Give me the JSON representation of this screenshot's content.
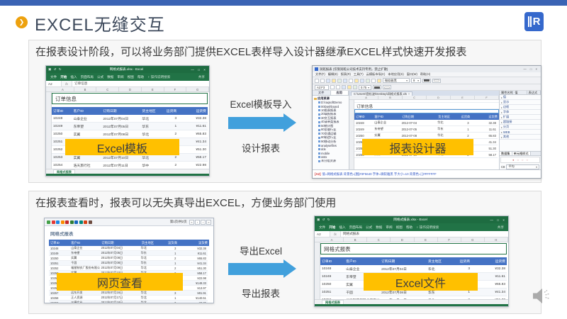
{
  "page": {
    "title": "EXCEL无缝交互",
    "logo_letter": "R",
    "accent_blue": "#3A63B4",
    "bullet_orange": "#EDA10E",
    "label_yellow": "#FFC000",
    "arrow_blue": "#41A0DC"
  },
  "section1": {
    "text": "在报表设计阶段，可以将业务部门提供EXCEL表样导入设计器继承EXCEL样式快速开发报表",
    "arrow_label_top": "Excel模板导入",
    "arrow_label_bottom": "设计报表",
    "overlay_left": "Excel模板",
    "overlay_right": "报表设计器"
  },
  "section2": {
    "text": "在报表查看时，报表可以无失真导出EXCEL，方便业务部门使用",
    "arrow_label_top": "导出Excel",
    "arrow_label_bottom": "导出报表",
    "overlay_left": "网页查看",
    "overlay_right": "Excel文件"
  },
  "excel_template": {
    "window_title": "网格式报表.xlsx - Excel",
    "window_controls": "— □ ×",
    "qat": "▣ ↺ ↻",
    "ribbon_tabs": [
      "文件",
      "开始",
      "插入",
      "页面布局",
      "公式",
      "数据",
      "审阅",
      "视图",
      "帮助"
    ],
    "tell_me": "♀ 操作说明搜索",
    "share": "共享",
    "name_box": "A2",
    "fx": "fx",
    "formula": "订单信息",
    "columns": [
      "A",
      "B",
      "C",
      "D",
      "E",
      "F",
      "G"
    ],
    "title_cell": "订单信息",
    "headers": [
      "订单ID",
      "客户ID",
      "订购日期",
      "货主地区",
      "运货商",
      "运货费"
    ],
    "rows": [
      [
        "10248",
        "山泰企业",
        "2012年07月04日",
        "华北",
        "3",
        "¥32.38"
      ],
      [
        "10249",
        "东帝望",
        "2012年07月05日",
        "华东",
        "1",
        "¥11.61"
      ],
      [
        "10250",
        "实翼",
        "2012年07月08日",
        "华北",
        "2",
        "¥65.83"
      ],
      [
        "10251",
        "千固",
        "2012年07月08日",
        "华东",
        "1",
        "¥41.34"
      ],
      [
        "10252",
        "福星制衣厂股份有限公司",
        "2012年07月09日",
        "华北",
        "2",
        "¥51.30"
      ],
      [
        "10253",
        "实翼",
        "2012年07月10日",
        "华北",
        "2",
        "¥58.17"
      ],
      [
        "10254",
        "浩天旅行社",
        "2012年07月11日",
        "华中",
        "2",
        "¥22.98"
      ]
    ],
    "sheet_tab": "网格式报表"
  },
  "designer": {
    "window_title": "润乾报表 (仅限润乾公司技术支持专用，禁止扩散)",
    "window_controls": "— □ ×",
    "menus": [
      "文件(F)",
      "编辑(E)",
      "报表(R)",
      "工具(T)",
      "云模板市场(C)",
      "本地应用(S)",
      "窗口(W)",
      "帮助(H)"
    ],
    "toolbar1_icons": [
      "new-icon",
      "open-icon",
      "save-icon",
      "save-all-icon",
      "print-icon",
      "bold-icon",
      "italic-icon",
      "underline-icon",
      "align-left-icon",
      "align-center-icon",
      "align-right-icon",
      "merge-cell-icon"
    ],
    "font_name": "微软雅黑",
    "font_size": "9",
    "toolbar2_icons": [
      "paste-icon",
      "format-painter-icon",
      "font-color-icon",
      "fill-color-icon",
      "zoom-icon"
    ],
    "cell_ref": "A2:F3",
    "zoom": "0.75",
    "left_tabs": [
      "文件",
      "应用"
    ],
    "tree_root": "应用资源",
    "tree_items": [
      "D:\\raqsoftDemo",
      "00Dashboard",
      "10图表报表",
      "20填报报表",
      "30交互报表",
      "40清单类报表",
      "50统计图",
      "60金融行业",
      "70交通运输",
      "80制造行业",
      "90移动分析",
      "analysefiles",
      "ddx",
      "mobile",
      "wstx",
      "未分组资源"
    ],
    "doc_tab": "C:\\Users\\登松波\\Desktop\\网格式报表.xls",
    "doc_tab_close": "×",
    "columns": [
      "A",
      "B",
      "C",
      "D",
      "E",
      "F"
    ],
    "title_cell": "订单信息",
    "headers": [
      "订单ID",
      "客户ID",
      "订购日期",
      "货主地区",
      "运货商",
      "运货费"
    ],
    "rows": [
      [
        "10248",
        "山泰企业",
        "2012-07-04",
        "华北",
        "3",
        "32.38"
      ],
      [
        "10249",
        "东帝望",
        "2012-07-05",
        "华东",
        "1",
        "11.61"
      ],
      [
        "10250",
        "实翼",
        "2012-07-08",
        "华北",
        "2",
        "65.83"
      ],
      [
        "10251",
        "千固",
        "2012-07-08",
        "华东",
        "1",
        "41.34"
      ],
      [
        "10252",
        "福星制衣厂股份有限公司",
        "2012-07-09",
        "华北",
        "2",
        "51.30"
      ],
      [
        "10253",
        "实翼",
        "2012-07-10",
        "华北",
        "2",
        "58.17"
      ]
    ],
    "prop_header": [
      "属性名称",
      "值",
      "表达式"
    ],
    "props": [
      "值",
      "显示",
      "边框",
      "字体",
      "扩展",
      "超链接",
      "分页",
      "WEB",
      "其他"
    ],
    "bottom_tabs": [
      "数据集",
      "单元格样式"
    ],
    "radios": [
      "●",
      "○",
      "○",
      "○"
    ],
    "agg_label": "C8",
    "agg_value": "平均",
    "status_ref": "[A2]",
    "status_text": "值=网格式报表 背景色=[图]#3F5640 字体=微软雅黑 字大小=10 背景色=[ ]#FFFFFF"
  },
  "webview": {
    "toolbar_icons": [
      "save-icon",
      "print-icon",
      "export-pdf-icon",
      "export-excel-icon",
      "export-word-icon",
      "export-image-icon",
      "email-icon",
      "print-preview-icon",
      "refresh-icon",
      "setting-icon"
    ],
    "pager_label": "第1页/共2页",
    "nav_buttons": [
      "«",
      "‹",
      "›",
      "»"
    ],
    "report_title": "网格式报表",
    "headers": [
      "订单ID",
      "客户ID",
      "订购日期",
      "货主地区",
      "运货商",
      "运货费"
    ],
    "rows": [
      [
        "10248",
        "山泰企业",
        "2012年07月04日",
        "华北",
        "3",
        "¥32.38"
      ],
      [
        "10249",
        "东帝望",
        "2012年07月05日",
        "华东",
        "1",
        "¥11.61"
      ],
      [
        "10250",
        "实翼",
        "2012年07月08日",
        "华北",
        "2",
        "¥65.83"
      ],
      [
        "10251",
        "千固",
        "2012年07月08日",
        "华东",
        "1",
        "¥41.34"
      ],
      [
        "10252",
        "福星制衣厂股份有限公司",
        "2012年07月09日",
        "华北",
        "2",
        "¥51.30"
      ],
      [
        "10253",
        "实翼",
        "2012年07月10日",
        "华北",
        "2",
        "¥58.17"
      ],
      [
        "10254",
        "浩天旅行社",
        "2012年07月11日",
        "华中",
        "2",
        "¥22.98"
      ],
      [
        "10255",
        "永大企业",
        "2012年07月12日",
        "华北",
        "3",
        "¥148.33"
      ],
      [
        "10256",
        "凯诚国际顾问公司",
        "2012年07月15日",
        "华中",
        "3",
        "¥13.97"
      ],
      [
        "10257",
        "远东开发",
        "2012年07月16日",
        "华北",
        "3",
        "¥81.91"
      ],
      [
        "10258",
        "正人资源",
        "2012年07月17日",
        "华北",
        "1",
        "¥140.51"
      ],
      [
        "10259",
        "三捷实业",
        "2012年07月18日",
        "华北",
        "3",
        "¥3.25"
      ]
    ]
  },
  "excel_export": {
    "window_title": "网格式报表.xlsx - Excel",
    "window_controls": "— □ ×",
    "qat": "▣ ↺ ↻",
    "ribbon_tabs": [
      "文件",
      "开始",
      "插入",
      "页面布局",
      "公式",
      "数据",
      "审阅",
      "视图",
      "帮助"
    ],
    "tell_me": "♀ 操作说明搜索",
    "share": "共享",
    "name_box": "A2",
    "fx": "fx",
    "formula": "网格式报表",
    "columns": [
      "A",
      "B",
      "C",
      "D",
      "E",
      "F",
      "G",
      "H"
    ],
    "title_cell": "网格式报表",
    "headers": [
      "订单ID",
      "客户ID",
      "订购日期",
      "货主地区",
      "运货商",
      "运货费"
    ],
    "rows": [
      [
        "10248",
        "山泰企业",
        "2012年07月04日",
        "华北",
        "3",
        "¥32.38"
      ],
      [
        "10249",
        "东帝望",
        "2012年07月05日",
        "华东",
        "1",
        "¥11.61"
      ],
      [
        "10250",
        "实翼",
        "2012年07月08日",
        "华北",
        "2",
        "¥65.83"
      ],
      [
        "10251",
        "千固",
        "2012年07月08日",
        "华东",
        "1",
        "¥41.34"
      ],
      [
        "10252",
        "福星制衣厂股份有限公司",
        "2012年07月09日",
        "华北",
        "2",
        "¥51.30"
      ]
    ],
    "sheet_tab": "网格式报表"
  }
}
